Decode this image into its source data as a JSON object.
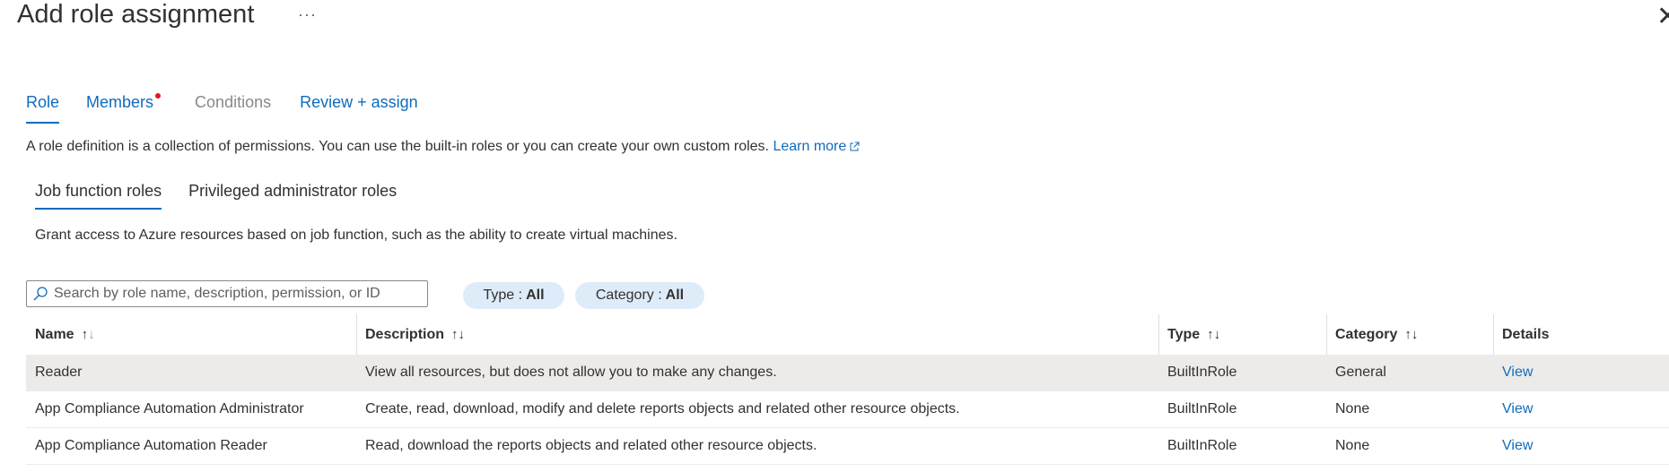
{
  "header": {
    "title": "Add role assignment",
    "more": "···",
    "close": "✕"
  },
  "tabs": [
    {
      "label": "Role"
    },
    {
      "label": "Members"
    },
    {
      "label": "Conditions"
    },
    {
      "label": "Review + assign"
    }
  ],
  "intro": {
    "text": "A role definition is a collection of permissions. You can use the built-in roles or you can create your own custom roles.",
    "link": "Learn more"
  },
  "subtabs": [
    {
      "label": "Job function roles"
    },
    {
      "label": "Privileged administrator roles"
    }
  ],
  "subtab_description": "Grant access to Azure resources based on job function, such as the ability to create virtual machines.",
  "search": {
    "placeholder": "Search by role name, description, permission, or ID"
  },
  "filters": [
    {
      "label": "Type :",
      "value": "All"
    },
    {
      "label": "Category :",
      "value": "All"
    }
  ],
  "table": {
    "headers": [
      "Name",
      "Description",
      "Type",
      "Category",
      "Details"
    ],
    "rows": [
      {
        "name": "Reader",
        "description": "View all resources, but does not allow you to make any changes.",
        "type": "BuiltInRole",
        "category": "General",
        "details": "View"
      },
      {
        "name": "App Compliance Automation Administrator",
        "description": "Create, read, download, modify and delete reports objects and related other resource objects.",
        "type": "BuiltInRole",
        "category": "None",
        "details": "View"
      },
      {
        "name": "App Compliance Automation Reader",
        "description": "Read, download the reports objects and related other resource objects.",
        "type": "BuiltInRole",
        "category": "None",
        "details": "View"
      }
    ]
  },
  "colors": {
    "accent": "#0f6cbd",
    "pill_bg": "#deecf9",
    "selected_row": "#edebe9",
    "notification_dot": "#e81123"
  }
}
